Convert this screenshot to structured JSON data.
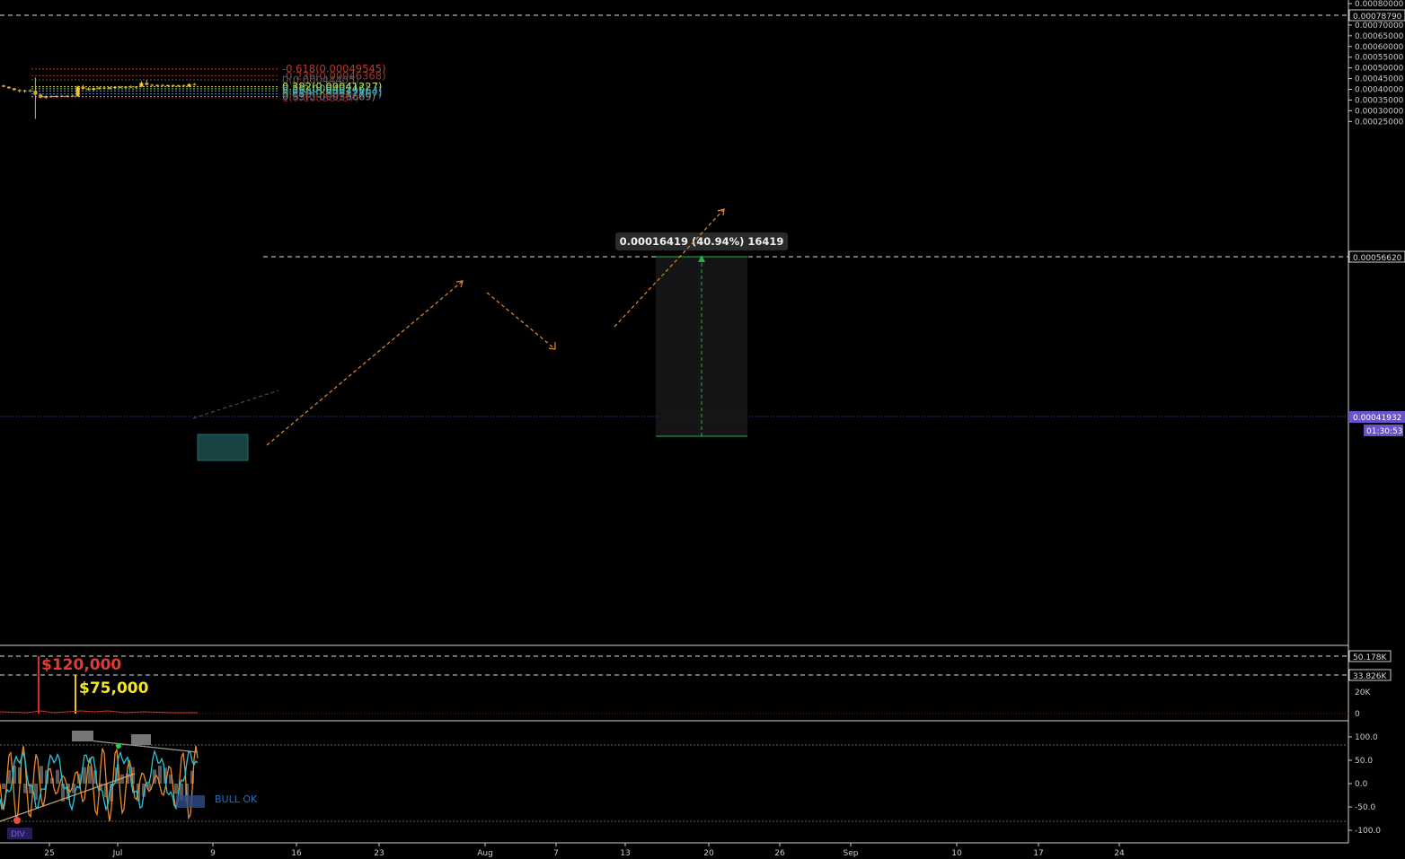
{
  "chart_data": {
    "type": "candlestick",
    "price_axis": {
      "ticks": [
        "0.00080000",
        "0.00075000",
        "0.00070000",
        "0.00065000",
        "0.00060000",
        "0.00055000",
        "0.00050000",
        "0.00045000",
        "0.00040000",
        "0.00035000",
        "0.00030000",
        "0.00025000"
      ],
      "ylim": [
        0.00021,
        0.000806
      ]
    },
    "time_axis": {
      "ticks": [
        "25",
        "Jul",
        "9",
        "16",
        "23",
        "Aug",
        "7",
        "13",
        "20",
        "26",
        "Sep",
        "10",
        "17",
        "24"
      ],
      "xlim": [
        "2018-06-20",
        "2018-10-01"
      ]
    },
    "markers": {
      "upper_dashed": "0.00078790",
      "target_dashed": "0.00056620",
      "last_price": "0.00041932",
      "countdown": "01:30:53"
    },
    "fib_levels": [
      {
        "label": "-0.618(0.00049545)",
        "value": 0.00049545,
        "color": "#c0392b"
      },
      {
        "label": "-0.236(0.00046368)",
        "value": 0.00046368,
        "color": "#a93226"
      },
      {
        "label": "0(0.00044405)",
        "value": 0.00044405,
        "color": "#5a5a5a"
      },
      {
        "label": "0.382(0.00041227)",
        "value": 0.00041227,
        "color": "#d4e157"
      },
      {
        "label": "0.5(0.00040246)",
        "value": 0.00040246,
        "color": "#8bc34a"
      },
      {
        "label": "0.618(0.00039264)",
        "value": 0.00039264,
        "color": "#26c6a6"
      },
      {
        "label": "0.786(0.00037867)",
        "value": 0.00037867,
        "color": "#3f8fd2"
      },
      {
        "label": "0.93(0.00036669)",
        "value": 0.00036669,
        "color": "#8a8a8a"
      },
      {
        "label": "1(0.00036087)",
        "value": 0.00036087,
        "color": "#8b2020"
      }
    ],
    "measure_label": "0.00016419 (40.94%) 16419",
    "candles": [
      {
        "o": 0.000418,
        "h": 0.000421,
        "l": 0.00041,
        "c": 0.000412
      },
      {
        "o": 0.000412,
        "h": 0.000414,
        "l": 0.000402,
        "c": 0.000405
      },
      {
        "o": 0.000405,
        "h": 0.000407,
        "l": 0.000393,
        "c": 0.000397
      },
      {
        "o": 0.000397,
        "h": 0.000401,
        "l": 0.000385,
        "c": 0.000392
      },
      {
        "o": 0.000392,
        "h": 0.000398,
        "l": 0.000384,
        "c": 0.000395
      },
      {
        "o": 0.000395,
        "h": 0.0004,
        "l": 0.000388,
        "c": 0.000393
      },
      {
        "o": 0.000393,
        "h": 0.000455,
        "l": 0.000262,
        "c": 0.000375
      },
      {
        "o": 0.000375,
        "h": 0.00038,
        "l": 0.000358,
        "c": 0.000362
      },
      {
        "o": 0.000362,
        "h": 0.000372,
        "l": 0.000356,
        "c": 0.000368
      },
      {
        "o": 0.000368,
        "h": 0.000373,
        "l": 0.000362,
        "c": 0.000366
      },
      {
        "o": 0.000366,
        "h": 0.000372,
        "l": 0.000362,
        "c": 0.000369
      },
      {
        "o": 0.000369,
        "h": 0.000374,
        "l": 0.000364,
        "c": 0.000367
      },
      {
        "o": 0.000367,
        "h": 0.000372,
        "l": 0.000363,
        "c": 0.00037
      },
      {
        "o": 0.00037,
        "h": 0.000375,
        "l": 0.000366,
        "c": 0.000368
      },
      {
        "o": 0.000368,
        "h": 0.000418,
        "l": 0.000366,
        "c": 0.000412
      },
      {
        "o": 0.000412,
        "h": 0.00042,
        "l": 0.000398,
        "c": 0.000403
      },
      {
        "o": 0.000403,
        "h": 0.00041,
        "l": 0.000394,
        "c": 0.000398
      },
      {
        "o": 0.000398,
        "h": 0.000408,
        "l": 0.000392,
        "c": 0.000405
      },
      {
        "o": 0.000405,
        "h": 0.000412,
        "l": 0.000398,
        "c": 0.000408
      },
      {
        "o": 0.000408,
        "h": 0.000414,
        "l": 0.000402,
        "c": 0.000404
      },
      {
        "o": 0.000404,
        "h": 0.000411,
        "l": 0.000399,
        "c": 0.000409
      },
      {
        "o": 0.000409,
        "h": 0.000415,
        "l": 0.000404,
        "c": 0.000411
      },
      {
        "o": 0.000411,
        "h": 0.000416,
        "l": 0.000405,
        "c": 0.000408
      },
      {
        "o": 0.000408,
        "h": 0.000414,
        "l": 0.000402,
        "c": 0.000412
      },
      {
        "o": 0.000412,
        "h": 0.000418,
        "l": 0.000407,
        "c": 0.00041
      },
      {
        "o": 0.00041,
        "h": 0.000415,
        "l": 0.000405,
        "c": 0.000413
      },
      {
        "o": 0.000413,
        "h": 0.000438,
        "l": 0.00041,
        "c": 0.00043
      },
      {
        "o": 0.00043,
        "h": 0.000444,
        "l": 0.000418,
        "c": 0.000421
      },
      {
        "o": 0.000421,
        "h": 0.000426,
        "l": 0.000414,
        "c": 0.000418
      },
      {
        "o": 0.000418,
        "h": 0.000424,
        "l": 0.000413,
        "c": 0.00042
      },
      {
        "o": 0.00042,
        "h": 0.000425,
        "l": 0.000414,
        "c": 0.000416
      },
      {
        "o": 0.000416,
        "h": 0.000423,
        "l": 0.000412,
        "c": 0.000419
      },
      {
        "o": 0.000419,
        "h": 0.000424,
        "l": 0.000413,
        "c": 0.000415
      },
      {
        "o": 0.000415,
        "h": 0.000422,
        "l": 0.000411,
        "c": 0.000418
      },
      {
        "o": 0.000418,
        "h": 0.000423,
        "l": 0.000412,
        "c": 0.000414
      },
      {
        "o": 0.000414,
        "h": 0.000428,
        "l": 0.00041,
        "c": 0.000424
      },
      {
        "o": 0.000424,
        "h": 0.00043,
        "l": 0.000418,
        "c": 0.00042
      }
    ],
    "volume": {
      "ticks": [
        "50.178K",
        "33.826K",
        "20K",
        "0"
      ],
      "annotations": [
        "$120,000",
        "$75,000"
      ]
    },
    "oscillator": {
      "ticks": [
        "100.0",
        "50.0",
        "0.0",
        "-50.0",
        "-100.0"
      ],
      "labels": [
        "BULL OK",
        "DIV"
      ]
    }
  }
}
